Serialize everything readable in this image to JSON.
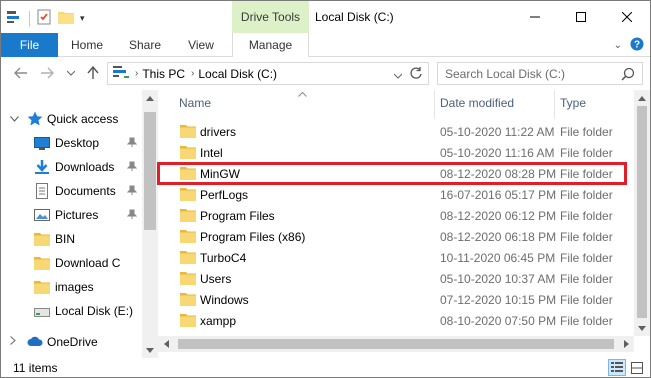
{
  "window": {
    "title": "Local Disk (C:)",
    "contextual_tab": "Drive Tools"
  },
  "ribbon": {
    "tabs": [
      "File",
      "Home",
      "Share",
      "View",
      "Manage"
    ]
  },
  "address": {
    "crumbs": [
      "This PC",
      "Local Disk (C:)"
    ],
    "search_placeholder": "Search Local Disk (C:)"
  },
  "nav": {
    "items": [
      {
        "label": "Quick access",
        "icon": "star-icon"
      },
      {
        "label": "Desktop",
        "icon": "desktop-icon",
        "pinned": true
      },
      {
        "label": "Downloads",
        "icon": "downloads-icon",
        "pinned": true
      },
      {
        "label": "Documents",
        "icon": "documents-icon",
        "pinned": true
      },
      {
        "label": "Pictures",
        "icon": "pictures-icon",
        "pinned": true
      },
      {
        "label": "BIN",
        "icon": "folder-icon"
      },
      {
        "label": "Download C",
        "icon": "folder-icon"
      },
      {
        "label": "images",
        "icon": "folder-icon"
      },
      {
        "label": "Local Disk (E:)",
        "icon": "drive-icon"
      },
      {
        "label": "OneDrive",
        "icon": "cloud-icon"
      }
    ]
  },
  "columns": {
    "name": "Name",
    "date": "Date modified",
    "type": "Type"
  },
  "files": [
    {
      "name": "drivers",
      "date": "05-10-2020 11:22 AM",
      "type": "File folder"
    },
    {
      "name": "Intel",
      "date": "05-10-2020 11:16 AM",
      "type": "File folder"
    },
    {
      "name": "MinGW",
      "date": "08-12-2020 08:28 PM",
      "type": "File folder"
    },
    {
      "name": "PerfLogs",
      "date": "16-07-2016 05:17 PM",
      "type": "File folder"
    },
    {
      "name": "Program Files",
      "date": "08-12-2020 06:12 PM",
      "type": "File folder"
    },
    {
      "name": "Program Files (x86)",
      "date": "08-12-2020 06:18 PM",
      "type": "File folder"
    },
    {
      "name": "TurboC4",
      "date": "10-11-2020 06:45 PM",
      "type": "File folder"
    },
    {
      "name": "Users",
      "date": "05-10-2020 10:37 AM",
      "type": "File folder"
    },
    {
      "name": "Windows",
      "date": "07-12-2020 10:15 PM",
      "type": "File folder"
    },
    {
      "name": "xampp",
      "date": "08-10-2020 07:50 PM",
      "type": "File folder"
    }
  ],
  "status": {
    "count": "11 items"
  },
  "colors": {
    "accent": "#1979ca",
    "highlight": "#e01f26",
    "folder": "#f8d775",
    "contextual": "#dcf1c8"
  }
}
